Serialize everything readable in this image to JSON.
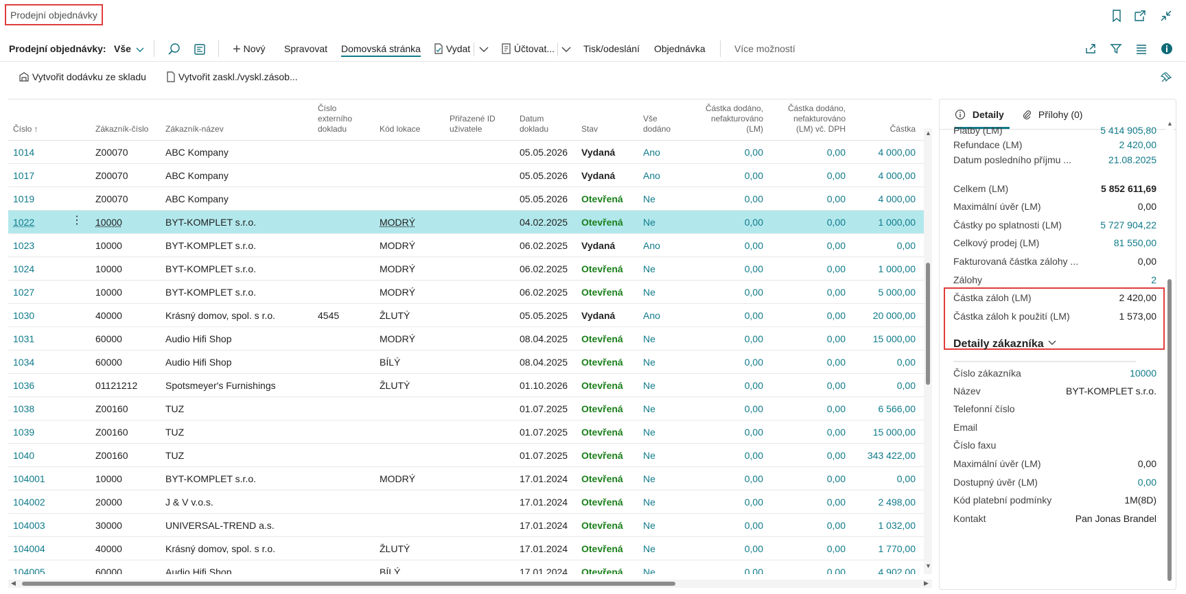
{
  "header": {
    "title": "Prodejní objednávky",
    "icons": [
      "bookmark-icon",
      "open-new-window-icon",
      "collapse-icon"
    ]
  },
  "actionbar": {
    "page_label": "Prodejní objednávky:",
    "view": "Vše",
    "new": "Nový",
    "manage": "Spravovat",
    "home": "Domovská stránka",
    "release": "Vydat",
    "post": "Účtovat...",
    "print": "Tisk/odeslání",
    "order": "Objednávka",
    "more": "Více možností"
  },
  "subbar": {
    "create_shipment": "Vytvořit dodávku ze skladu",
    "create_put_away": "Vytvořit zaskl./vyskl.zásob..."
  },
  "columns": {
    "number": "Číslo",
    "customer_no": "Zákazník-číslo",
    "customer_name": "Zákazník-název",
    "ext_doc_line1": "Číslo",
    "ext_doc_line2": "externího",
    "ext_doc_line3": "dokladu",
    "location": "Kód lokace",
    "assigned_line1": "Přiřazené ID",
    "assigned_line2": "uživatele",
    "date_line1": "Datum",
    "date_line2": "dokladu",
    "status": "Stav",
    "shipped_line1": "Vše",
    "shipped_line2": "dodáno",
    "amt1_line1": "Částka dodáno,",
    "amt1_line2": "nefakturováno",
    "amt1_line3": "(LM)",
    "amt2_line1": "Částka dodáno,",
    "amt2_line2": "nefakturováno",
    "amt2_line3": "(LM) vč. DPH",
    "amount": "Částka"
  },
  "rows": [
    {
      "no": "1014",
      "cust": "Z00070",
      "name": "ABC Kompany",
      "ext": "",
      "loc": "",
      "date": "05.05.2026",
      "status": "Vydaná",
      "shipped": "Ano",
      "a1": "0,00",
      "a2": "0,00",
      "amount": "4 000,00"
    },
    {
      "no": "1017",
      "cust": "Z00070",
      "name": "ABC Kompany",
      "ext": "",
      "loc": "",
      "date": "05.05.2026",
      "status": "Vydaná",
      "shipped": "Ano",
      "a1": "0,00",
      "a2": "0,00",
      "amount": "4 000,00"
    },
    {
      "no": "1019",
      "cust": "Z00070",
      "name": "ABC Kompany",
      "ext": "",
      "loc": "",
      "date": "05.05.2026",
      "status": "Otevřená",
      "shipped": "Ne",
      "a1": "0,00",
      "a2": "0,00",
      "amount": "4 000,00"
    },
    {
      "no": "1022",
      "cust": "10000",
      "name": "BYT-KOMPLET s.r.o.",
      "ext": "",
      "loc": "MODRÝ",
      "date": "04.02.2025",
      "status": "Otevřená",
      "shipped": "Ne",
      "a1": "0,00",
      "a2": "0,00",
      "amount": "1 000,00"
    },
    {
      "no": "1023",
      "cust": "10000",
      "name": "BYT-KOMPLET s.r.o.",
      "ext": "",
      "loc": "MODRÝ",
      "date": "06.02.2025",
      "status": "Vydaná",
      "shipped": "Ano",
      "a1": "0,00",
      "a2": "0,00",
      "amount": "0,00"
    },
    {
      "no": "1024",
      "cust": "10000",
      "name": "BYT-KOMPLET s.r.o.",
      "ext": "",
      "loc": "MODRÝ",
      "date": "06.02.2025",
      "status": "Otevřená",
      "shipped": "Ne",
      "a1": "0,00",
      "a2": "0,00",
      "amount": "1 000,00"
    },
    {
      "no": "1027",
      "cust": "10000",
      "name": "BYT-KOMPLET s.r.o.",
      "ext": "",
      "loc": "MODRÝ",
      "date": "06.02.2025",
      "status": "Otevřená",
      "shipped": "Ne",
      "a1": "0,00",
      "a2": "0,00",
      "amount": "5 000,00"
    },
    {
      "no": "1030",
      "cust": "40000",
      "name": "Krásný domov, spol. s r.o.",
      "ext": "4545",
      "loc": "ŽLUTÝ",
      "date": "05.05.2025",
      "status": "Vydaná",
      "shipped": "Ano",
      "a1": "0,00",
      "a2": "0,00",
      "amount": "20 000,00"
    },
    {
      "no": "1031",
      "cust": "60000",
      "name": "Audio Hifi Shop",
      "ext": "",
      "loc": "MODRÝ",
      "date": "08.04.2025",
      "status": "Otevřená",
      "shipped": "Ne",
      "a1": "0,00",
      "a2": "0,00",
      "amount": "15 000,00"
    },
    {
      "no": "1034",
      "cust": "60000",
      "name": "Audio Hifi Shop",
      "ext": "",
      "loc": "BÍLÝ",
      "date": "08.04.2025",
      "status": "Otevřená",
      "shipped": "Ne",
      "a1": "0,00",
      "a2": "0,00",
      "amount": "0,00"
    },
    {
      "no": "1036",
      "cust": "01121212",
      "name": "Spotsmeyer's Furnishings",
      "ext": "",
      "loc": "ŽLUTÝ",
      "date": "01.10.2026",
      "status": "Otevřená",
      "shipped": "Ne",
      "a1": "0,00",
      "a2": "0,00",
      "amount": "0,00"
    },
    {
      "no": "1038",
      "cust": "Z00160",
      "name": "TUZ",
      "ext": "",
      "loc": "",
      "date": "01.07.2025",
      "status": "Otevřená",
      "shipped": "Ne",
      "a1": "0,00",
      "a2": "0,00",
      "amount": "6 566,00"
    },
    {
      "no": "1039",
      "cust": "Z00160",
      "name": "TUZ",
      "ext": "",
      "loc": "",
      "date": "01.07.2025",
      "status": "Otevřená",
      "shipped": "Ne",
      "a1": "0,00",
      "a2": "0,00",
      "amount": "15 000,00"
    },
    {
      "no": "1040",
      "cust": "Z00160",
      "name": "TUZ",
      "ext": "",
      "loc": "",
      "date": "01.07.2025",
      "status": "Otevřená",
      "shipped": "Ne",
      "a1": "0,00",
      "a2": "0,00",
      "amount": "343 422,00"
    },
    {
      "no": "104001",
      "cust": "10000",
      "name": "BYT-KOMPLET s.r.o.",
      "ext": "",
      "loc": "MODRÝ",
      "date": "17.01.2024",
      "status": "Otevřená",
      "shipped": "Ne",
      "a1": "0,00",
      "a2": "0,00",
      "amount": "0,00"
    },
    {
      "no": "104002",
      "cust": "20000",
      "name": "J & V v.o.s.",
      "ext": "",
      "loc": "",
      "date": "17.01.2024",
      "status": "Otevřená",
      "shipped": "Ne",
      "a1": "0,00",
      "a2": "0,00",
      "amount": "2 498,00"
    },
    {
      "no": "104003",
      "cust": "30000",
      "name": "UNIVERSAL-TREND a.s.",
      "ext": "",
      "loc": "",
      "date": "17.01.2024",
      "status": "Otevřená",
      "shipped": "Ne",
      "a1": "0,00",
      "a2": "0,00",
      "amount": "1 032,00"
    },
    {
      "no": "104004",
      "cust": "40000",
      "name": "Krásný domov, spol. s r.o.",
      "ext": "",
      "loc": "ŽLUTÝ",
      "date": "17.01.2024",
      "status": "Otevřená",
      "shipped": "Ne",
      "a1": "0,00",
      "a2": "0,00",
      "amount": "1 770,00"
    },
    {
      "no": "104005",
      "cust": "60000",
      "name": "Audio Hifi Shop",
      "ext": "",
      "loc": "BÍLÝ",
      "date": "17.01.2024",
      "status": "Otevřená",
      "shipped": "Ne",
      "a1": "0,00",
      "a2": "0,00",
      "amount": "4 902,00"
    }
  ],
  "selected_row": 3,
  "factbox": {
    "tab_details": "Detaily",
    "tab_attachments": "Přílohy (0)",
    "stats": [
      {
        "label": "Platby (LM)",
        "value": "5 414 905,80",
        "link": true
      },
      {
        "label": "Refundace (LM)",
        "value": "2 420,00",
        "link": true
      },
      {
        "label": "Datum posledního příjmu ...",
        "value": "21.08.2025",
        "link": true
      },
      {
        "label": "Celkem (LM)",
        "value": "5 852 611,69",
        "bold": true
      },
      {
        "label": "Maximální úvěr (LM)",
        "value": "0,00"
      },
      {
        "label": "Částky po splatnosti (LM)",
        "value": "5 727 904,22",
        "link": true
      },
      {
        "label": "Celkový prodej (LM)",
        "value": "81 550,00",
        "link": true
      },
      {
        "label": "Fakturovaná částka zálohy ...",
        "value": "0,00"
      },
      {
        "label": "Zálohy",
        "value": "2",
        "link": true
      },
      {
        "label": "Částka záloh (LM)",
        "value": "2 420,00"
      },
      {
        "label": "Částka záloh k použití (LM)",
        "value": "1 573,00"
      }
    ],
    "customer_section_title": "Detaily zákazníka",
    "customer": [
      {
        "label": "Číslo zákazníka",
        "value": "10000",
        "link": true
      },
      {
        "label": "Název",
        "value": "BYT-KOMPLET s.r.o."
      },
      {
        "label": "Telefonní číslo",
        "value": ""
      },
      {
        "label": "Email",
        "value": ""
      },
      {
        "label": "Číslo faxu",
        "value": ""
      },
      {
        "label": "Maximální úvěr (LM)",
        "value": "0,00"
      },
      {
        "label": "Dostupný úvěr (LM)",
        "value": "0,00",
        "link": true
      },
      {
        "label": "Kód platební podmínky",
        "value": "1M(8D)"
      },
      {
        "label": "Kontakt",
        "value": "Pan Jonas Brandel"
      }
    ]
  },
  "colors": {
    "accent": "#0f7a8a",
    "selected_row": "#b2e8ec",
    "open_status": "#1a7f1a",
    "highlight_box": "#e03c3c"
  }
}
